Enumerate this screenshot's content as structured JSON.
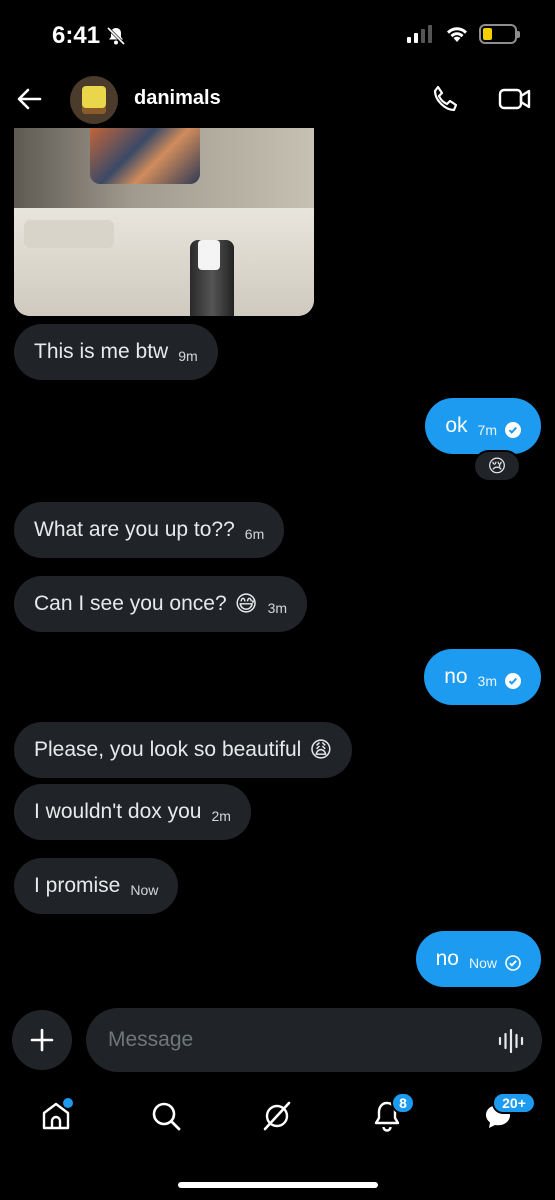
{
  "status_bar": {
    "time": "6:41",
    "icons": [
      "bell-slash-icon",
      "signal-icon",
      "wifi-icon",
      "battery-low-icon"
    ],
    "battery_color": "#f4d000"
  },
  "header": {
    "username": "danimals",
    "icons": [
      "back-arrow-icon",
      "phone-icon",
      "video-camera-icon"
    ]
  },
  "messages": [
    {
      "from": "them",
      "text": "This is me btw",
      "time": "9m"
    },
    {
      "from": "me",
      "text": "ok",
      "time": "7m",
      "reaction": "😢"
    },
    {
      "from": "them",
      "text": "What are you up to??",
      "time": "6m"
    },
    {
      "from": "them",
      "text": "Can I see you once?",
      "emoji": "😅",
      "time": "3m"
    },
    {
      "from": "me",
      "text": "no",
      "time": "3m"
    },
    {
      "from": "them",
      "text": "Please, you look so beautiful",
      "emoji": "😩",
      "time": ""
    },
    {
      "from": "them",
      "text": "I wouldn't dox you",
      "time": "2m"
    },
    {
      "from": "them",
      "text": "I promise",
      "time": "Now"
    },
    {
      "from": "me",
      "text": "no",
      "time": "Now"
    }
  ],
  "composer": {
    "placeholder": "Message"
  },
  "tabbar": {
    "notifications_badge": "8",
    "messages_badge": "20+",
    "accent": "#1d9bf0"
  }
}
